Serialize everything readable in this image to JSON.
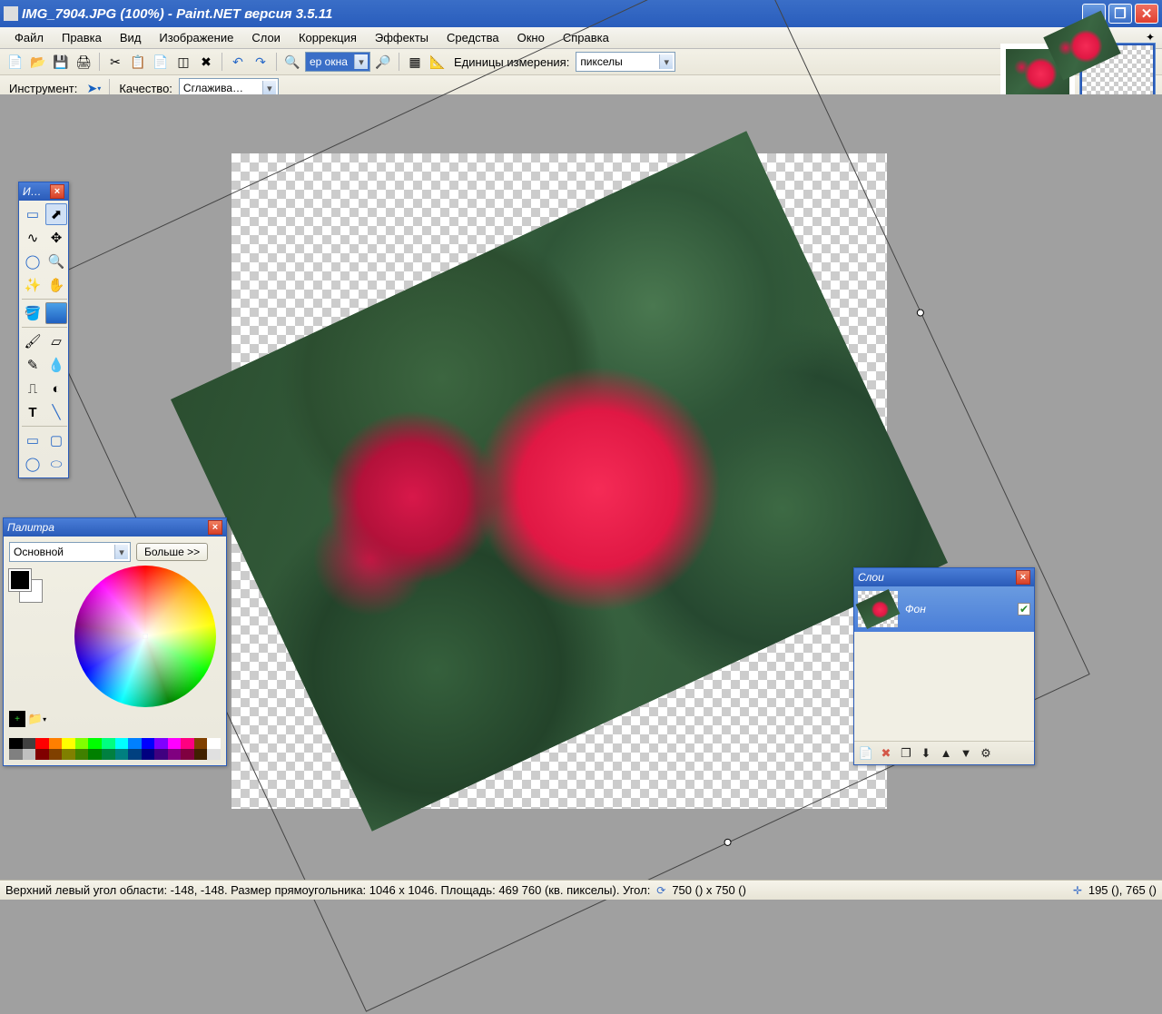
{
  "title": "IMG_7904.JPG (100%) - Paint.NET версия 3.5.11",
  "menu": [
    "Файл",
    "Правка",
    "Вид",
    "Изображение",
    "Слои",
    "Коррекция",
    "Эффекты",
    "Средства",
    "Окно",
    "Справка"
  ],
  "toolbar1": {
    "zoom_value": "ер окна",
    "units_label": "Единицы измерения:",
    "units_value": "пикселы"
  },
  "toolbar2": {
    "instrument_label": "Инструмент:",
    "quality_label": "Качество:",
    "quality_value": "Сглажива…"
  },
  "tools_window": {
    "title": "И…"
  },
  "palette_window": {
    "title": "Палитра",
    "mode": "Основной",
    "more": "Больше >>"
  },
  "layers_window": {
    "title": "Слои",
    "layer_name": "Фон"
  },
  "status": {
    "text": "Верхний левый угол области: -148, -148. Размер прямоугольника: 1046 x 1046. Площадь: 469 760 (кв. пикселы). Угол:",
    "angle": "750 () x 750 ()",
    "cursor": "195 (), 765 ()"
  },
  "palette_colors_top": [
    "#000000",
    "#404040",
    "#ff0000",
    "#ff7f00",
    "#ffff00",
    "#80ff00",
    "#00ff00",
    "#00ff80",
    "#00ffff",
    "#0080ff",
    "#0000ff",
    "#8000ff",
    "#ff00ff",
    "#ff0080",
    "#804000",
    "#ffffff"
  ],
  "palette_colors_bottom": [
    "#808080",
    "#c0c0c0",
    "#800000",
    "#804000",
    "#808000",
    "#408000",
    "#008000",
    "#008040",
    "#008080",
    "#004080",
    "#000080",
    "#400080",
    "#800080",
    "#800040",
    "#402000",
    "#e0e0e0"
  ]
}
